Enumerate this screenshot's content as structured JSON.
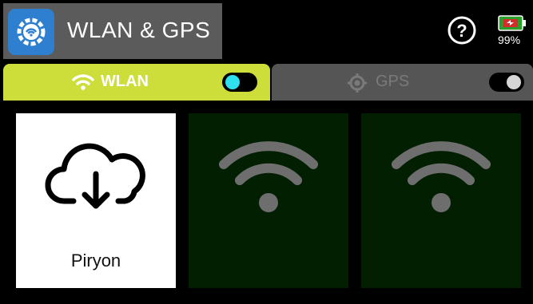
{
  "header": {
    "app_title": "WLAN & GPS",
    "app_icon": "wlan-gps-gear-icon",
    "help_icon": "question-circle-icon",
    "battery_icon": "battery-icon",
    "battery_percent": "99%"
  },
  "tabs": [
    {
      "label": "WLAN",
      "icon": "wifi-icon",
      "active": true,
      "toggle_on": true
    },
    {
      "label": "GPS",
      "icon": "gps-target-icon",
      "active": false,
      "toggle_on": false
    }
  ],
  "tiles": [
    {
      "label": "Piryon",
      "icon": "cloud-download-icon",
      "selected": true
    },
    {
      "label": "",
      "icon": "wifi-signal-icon",
      "selected": false
    },
    {
      "label": "",
      "icon": "wifi-signal-icon",
      "selected": false
    }
  ],
  "colors": {
    "active_tab": "#cddd3a",
    "inactive_tab": "#555555",
    "toggle_on_knob": "#2fe0ee",
    "tile_dark": "#021f02",
    "app_icon_bg": "#2f7fd0"
  }
}
